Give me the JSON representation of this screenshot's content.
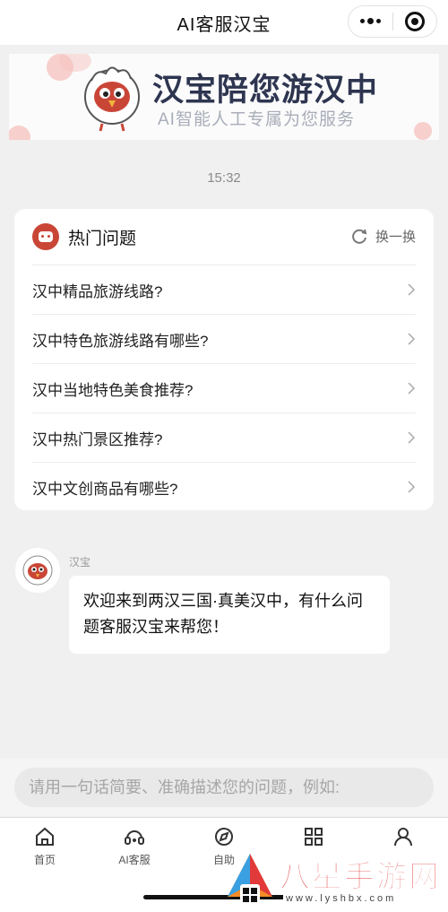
{
  "header": {
    "title": "AI客服汉宝",
    "more_icon": "more-dots-icon",
    "close_icon": "target-icon"
  },
  "banner": {
    "title": "汉宝陪您游汉中",
    "subtitle": "AI智能人工专属为您服务"
  },
  "chat_time": "15:32",
  "hot_questions": {
    "title": "热门问题",
    "refresh_label": "换一换",
    "items": [
      {
        "text": "汉中精品旅游线路?"
      },
      {
        "text": "汉中特色旅游线路有哪些?"
      },
      {
        "text": "汉中当地特色美食推荐?"
      },
      {
        "text": "汉中热门景区推荐?"
      },
      {
        "text": "汉中文创商品有哪些?"
      }
    ]
  },
  "message": {
    "sender": "汉宝",
    "text": "欢迎来到两汉三国·真美汉中，有什么问题客服汉宝来帮您！"
  },
  "input": {
    "placeholder": "请用一句话简要、准确描述您的问题，例如:"
  },
  "tabs": [
    {
      "label": "首页",
      "icon": "home-icon"
    },
    {
      "label": "AI客服",
      "icon": "headset-icon"
    },
    {
      "label": "自助",
      "icon": "compass-icon"
    },
    {
      "label": "",
      "icon": "grid-icon"
    },
    {
      "label": "",
      "icon": "user-icon"
    }
  ],
  "watermark": {
    "title": "八星手游网",
    "url": "www.lyshbx.com"
  },
  "colors": {
    "accent": "#c94637",
    "banner_title": "#2e3550",
    "watermark": "#e23a3a"
  }
}
